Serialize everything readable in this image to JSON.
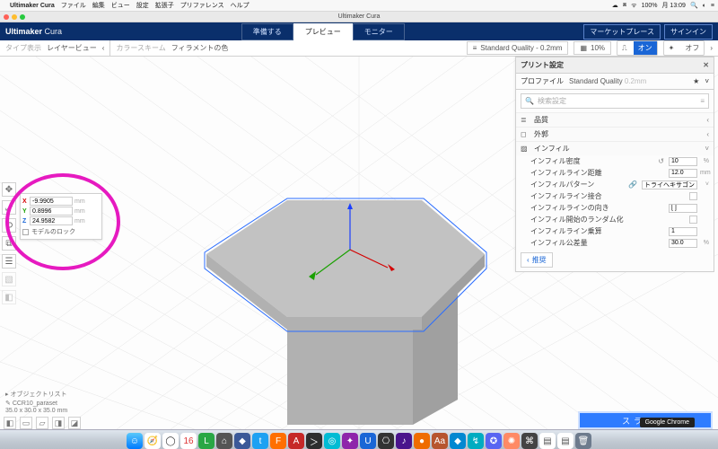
{
  "mac": {
    "app": "Ultimaker Cura",
    "menus": [
      "ファイル",
      "編集",
      "ビュー",
      "設定",
      "拡張子",
      "プリファレンス",
      "ヘルプ"
    ],
    "right": [
      "100%",
      "月 13:09"
    ]
  },
  "window": {
    "title": "Ultimaker Cura"
  },
  "brand": {
    "a": "Ultimaker",
    "b": " Cura"
  },
  "stage_tabs": {
    "prepare": "準備する",
    "preview": "プレビュー",
    "monitor": "モニター"
  },
  "top_right": {
    "marketplace": "マーケットプレース",
    "signin": "サインイン"
  },
  "sec": {
    "type_label": "タイプ表示",
    "type_value": "レイヤービュー",
    "scheme_label": "カラースキーム",
    "scheme_value": "フィラメントの色",
    "printer": "Standard Quality - 0.2mm",
    "infillpct": "10%",
    "on": "オン",
    "off": "オフ"
  },
  "xform": {
    "x": "-9.9905",
    "y": "0.8996",
    "z": "24.9582",
    "unit": "mm",
    "lock": "モデルのロック"
  },
  "panel": {
    "title": "プリント設定",
    "profile_label": "プロファイル",
    "profile_value": "Standard Quality",
    "profile_hint": "0.2mm",
    "search_ph": "検索設定",
    "sec_quality": "品質",
    "sec_shell": "外郭",
    "sec_infill": "インフィル",
    "kv": {
      "infill_density_k": "インフィル密度",
      "infill_density_v": "10",
      "pct": "%",
      "infill_line_dist_k": "インフィルライン距離",
      "infill_line_dist_v": "12.0",
      "mm": "mm",
      "infill_pattern_k": "インフィルパターン",
      "infill_pattern_v": "トライヘキサゴン",
      "infill_line_connect_k": "インフィルライン接合",
      "infill_line_dir_k": "インフィルラインの向き",
      "infill_line_dir_v": "[ ]",
      "infill_random_start_k": "インフィル開始のランダム化",
      "infill_mult_k": "インフィルライン乗算",
      "infill_mult_v": "1",
      "infill_overlap_k": "インフィル公差量",
      "infill_overlap_v": "30.0"
    },
    "recommend": "推奨"
  },
  "objlist": {
    "header": "オブジェクトリスト",
    "file": "CCR10_paraset",
    "dims": "35.0 x 30.0 x 35.0 mm"
  },
  "slice": "スライス",
  "noti": "Google Chrome"
}
